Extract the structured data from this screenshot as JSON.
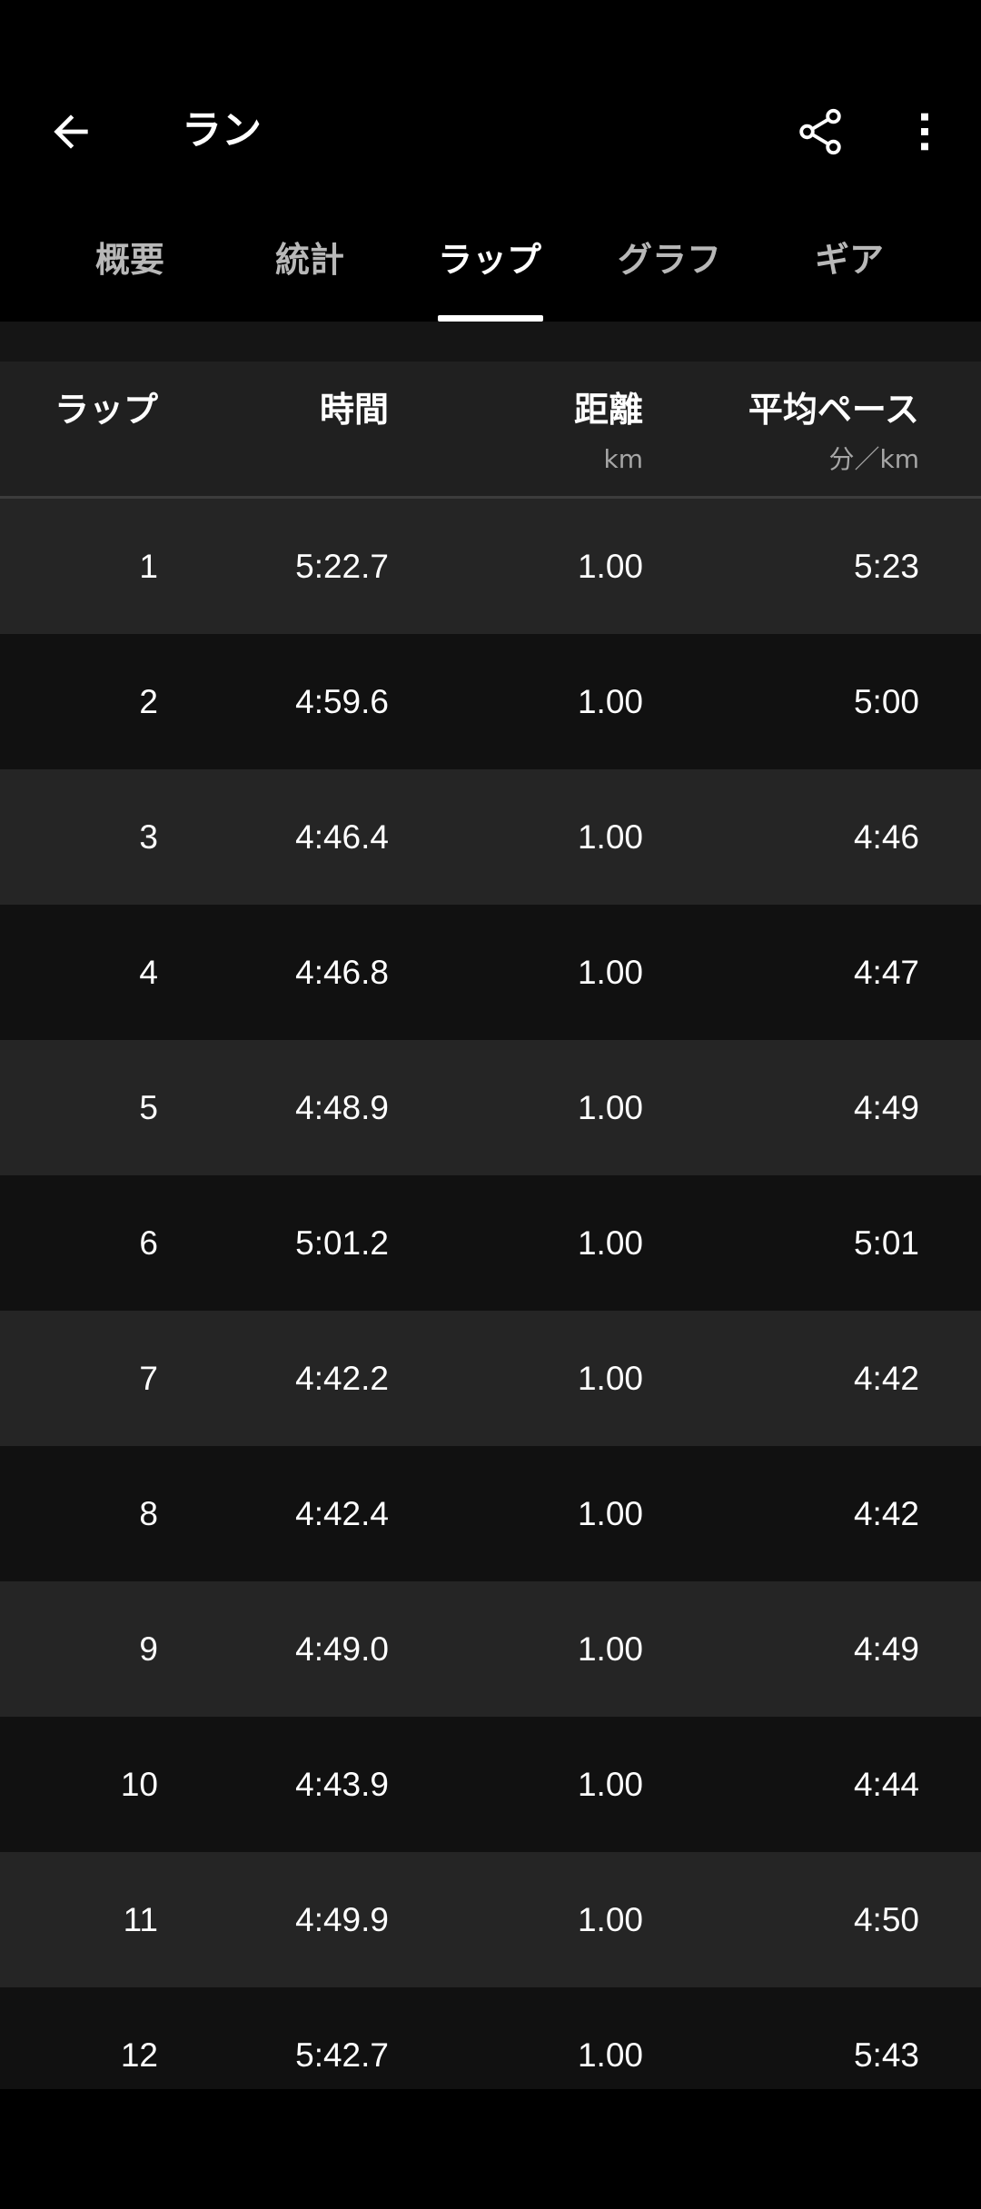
{
  "appbar": {
    "title": "ラン",
    "back_icon": "arrow-left-icon",
    "share_icon": "share-icon",
    "more_icon": "more-vert-icon"
  },
  "tabs": [
    {
      "label": "概要",
      "active": false
    },
    {
      "label": "統計",
      "active": false
    },
    {
      "label": "ラップ",
      "active": true
    },
    {
      "label": "グラフ",
      "active": false
    },
    {
      "label": "ギア",
      "active": false
    }
  ],
  "table": {
    "headers": {
      "lap": "ラップ",
      "time": "時間",
      "distance": "距離",
      "distance_unit": "km",
      "pace": "平均ペース",
      "pace_unit": "分／km"
    },
    "rows": [
      {
        "lap": "1",
        "time": "5:22.7",
        "distance": "1.00",
        "pace": "5:23"
      },
      {
        "lap": "2",
        "time": "4:59.6",
        "distance": "1.00",
        "pace": "5:00"
      },
      {
        "lap": "3",
        "time": "4:46.4",
        "distance": "1.00",
        "pace": "4:46"
      },
      {
        "lap": "4",
        "time": "4:46.8",
        "distance": "1.00",
        "pace": "4:47"
      },
      {
        "lap": "5",
        "time": "4:48.9",
        "distance": "1.00",
        "pace": "4:49"
      },
      {
        "lap": "6",
        "time": "5:01.2",
        "distance": "1.00",
        "pace": "5:01"
      },
      {
        "lap": "7",
        "time": "4:42.2",
        "distance": "1.00",
        "pace": "4:42"
      },
      {
        "lap": "8",
        "time": "4:42.4",
        "distance": "1.00",
        "pace": "4:42"
      },
      {
        "lap": "9",
        "time": "4:49.0",
        "distance": "1.00",
        "pace": "4:49"
      },
      {
        "lap": "10",
        "time": "4:43.9",
        "distance": "1.00",
        "pace": "4:44"
      },
      {
        "lap": "11",
        "time": "4:49.9",
        "distance": "1.00",
        "pace": "4:50"
      },
      {
        "lap": "12",
        "time": "5:42.7",
        "distance": "1.00",
        "pace": "5:43"
      }
    ]
  },
  "colors": {
    "background": "#000000",
    "row_odd": "#252525",
    "row_even": "#111111",
    "header_bg": "#202020",
    "text": "#ffffff",
    "muted": "#a6a6a6"
  }
}
